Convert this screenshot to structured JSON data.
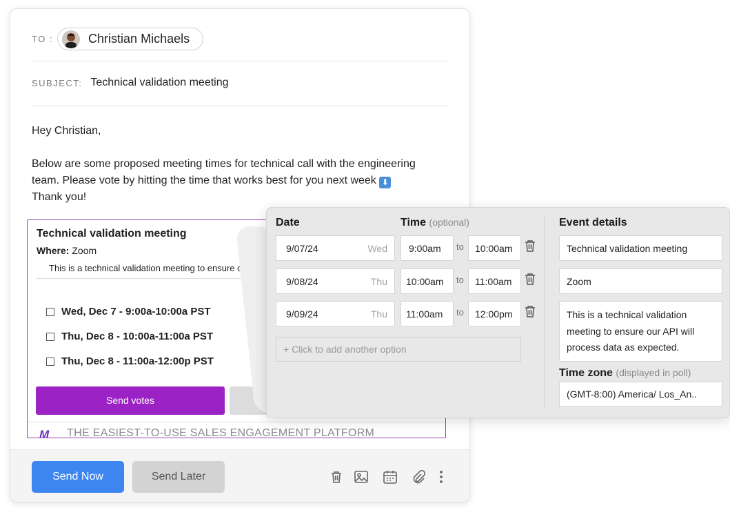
{
  "email": {
    "to_label": "TO :",
    "recipient_name": "Christian Michaels",
    "subject_label": "SUBJECT:",
    "subject": "Technical validation meeting",
    "greeting": "Hey Christian,",
    "body_line1": "Below are some proposed meeting times for technical call with the engineering",
    "body_line2": "team.  Please vote by hitting the time that works best for you next week",
    "body_line3": "Thank you!",
    "down_emoji": "⬇"
  },
  "poll": {
    "title": "Technical validation meeting",
    "where_label": "Where:",
    "where_value": "Zoom",
    "description": "This is a technical validation meeting to ensure our API",
    "options": [
      "Wed, Dec 7 - 9:00a-10:00a PST",
      "Thu, Dec 8 - 10:00a-11:00a PST",
      "Thu, Dec 8 - 11:00a-12:00p PST"
    ],
    "send_votes_label": "Send votes",
    "brand_mark": "M",
    "tagline": "THE EASIEST-TO-USE SALES ENGAGEMENT PLATFORM"
  },
  "toolbar": {
    "send_now": "Send Now",
    "send_later": "Send Later",
    "icons": [
      "trash-icon",
      "image-icon",
      "calendar-icon",
      "paperclip-icon",
      "more-vertical-icon"
    ]
  },
  "editor": {
    "date_header": "Date",
    "time_header": "Time",
    "time_hint": "(optional)",
    "details_header": "Event details",
    "to_word": "to",
    "rows": [
      {
        "date": "9/07/24",
        "day": "Wed",
        "start": "9:00am",
        "end": "10:00am"
      },
      {
        "date": "9/08/24",
        "day": "Thu",
        "start": "10:00am",
        "end": "11:00am"
      },
      {
        "date": "9/09/24",
        "day": "Thu",
        "start": "11:00am",
        "end": "12:00pm"
      }
    ],
    "add_option": "+ Click to add another option",
    "event_title": "Technical validation meeting",
    "event_location": "Zoom",
    "event_description": "This is a technical validation meeting to ensure our API will process data as expected.",
    "timezone_label": "Time zone",
    "timezone_hint": "(displayed in poll)",
    "timezone_value": "(GMT-8:00) America/ Los_An.."
  },
  "colors": {
    "primary_blue": "#3d86f0",
    "poll_purple": "#9b22c4",
    "panel_gray": "#e8e8e8"
  }
}
